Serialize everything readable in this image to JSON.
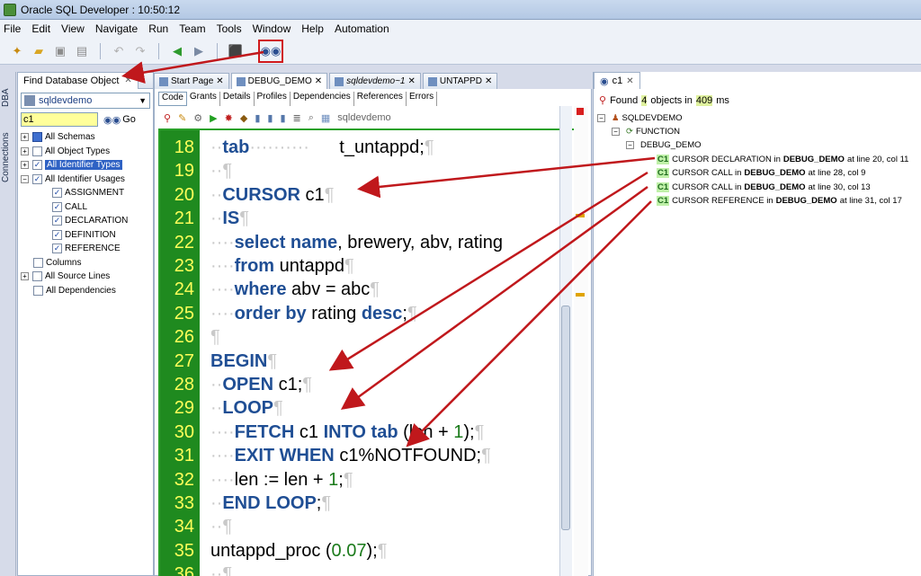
{
  "window": {
    "title": "Oracle SQL Developer : 10:50:12"
  },
  "menu": [
    "File",
    "Edit",
    "View",
    "Navigate",
    "Run",
    "Team",
    "Tools",
    "Window",
    "Help",
    "Automation"
  ],
  "left_strip": {
    "dba": "DBA",
    "connections": "Connections"
  },
  "find_panel": {
    "tab_label": "Find Database Object",
    "connection": "sqldevdemo",
    "search_value": "c1",
    "go_label": "Go",
    "tree": [
      {
        "label": "All Schemas",
        "checked": "blue"
      },
      {
        "label": "All Object Types",
        "checked": "none"
      },
      {
        "label": "All Identifier Types",
        "checked": "yes"
      },
      {
        "label": "All Identifier Usages",
        "checked": "yes"
      },
      {
        "label": "ASSIGNMENT",
        "checked": "yes"
      },
      {
        "label": "CALL",
        "checked": "yes"
      },
      {
        "label": "DECLARATION",
        "checked": "yes"
      },
      {
        "label": "DEFINITION",
        "checked": "yes"
      },
      {
        "label": "REFERENCE",
        "checked": "yes"
      },
      {
        "label": "Columns",
        "checked": "none"
      },
      {
        "label": "All Source Lines",
        "checked": "none"
      },
      {
        "label": "All Dependencies",
        "checked": "none"
      }
    ]
  },
  "doc_tabs": [
    "Start Page",
    "DEBUG_DEMO",
    "sqldevdemo~1",
    "UNTAPPD"
  ],
  "editor": {
    "subtabs": [
      "Code",
      "Grants",
      "Details",
      "Profiles",
      "Dependencies",
      "References",
      "Errors"
    ],
    "connection": "sqldevdemo",
    "line_numbers": [
      "18",
      "19",
      "20",
      "21",
      "22",
      "23",
      "24",
      "25",
      "26",
      "27",
      "28",
      "29",
      "30",
      "31",
      "32",
      "33",
      "34",
      "35",
      "36"
    ]
  },
  "results": {
    "tab_label": "c1",
    "found_prefix": "Found",
    "found_count": "4",
    "found_mid": "objects in",
    "found_ms": "409",
    "found_suffix": "ms",
    "schema": "SQLDEVDEMO",
    "object_type": "FUNCTION",
    "object_name": "DEBUG_DEMO",
    "items": [
      {
        "tag": "C1",
        "text": "CURSOR DECLARATION in",
        "obj": "DEBUG_DEMO",
        "loc": "at line 20, col 11"
      },
      {
        "tag": "C1",
        "text": "CURSOR CALL in",
        "obj": "DEBUG_DEMO",
        "loc": "at line 28, col 9"
      },
      {
        "tag": "C1",
        "text": "CURSOR CALL in",
        "obj": "DEBUG_DEMO",
        "loc": "at line 30, col 13"
      },
      {
        "tag": "C1",
        "text": "CURSOR REFERENCE in",
        "obj": "DEBUG_DEMO",
        "loc": "at line 31, col 17"
      }
    ]
  },
  "colors": {
    "annotation_arrow": "#c0181c",
    "gutter": "#1f8a1f",
    "keyword": "#1f4e94"
  }
}
